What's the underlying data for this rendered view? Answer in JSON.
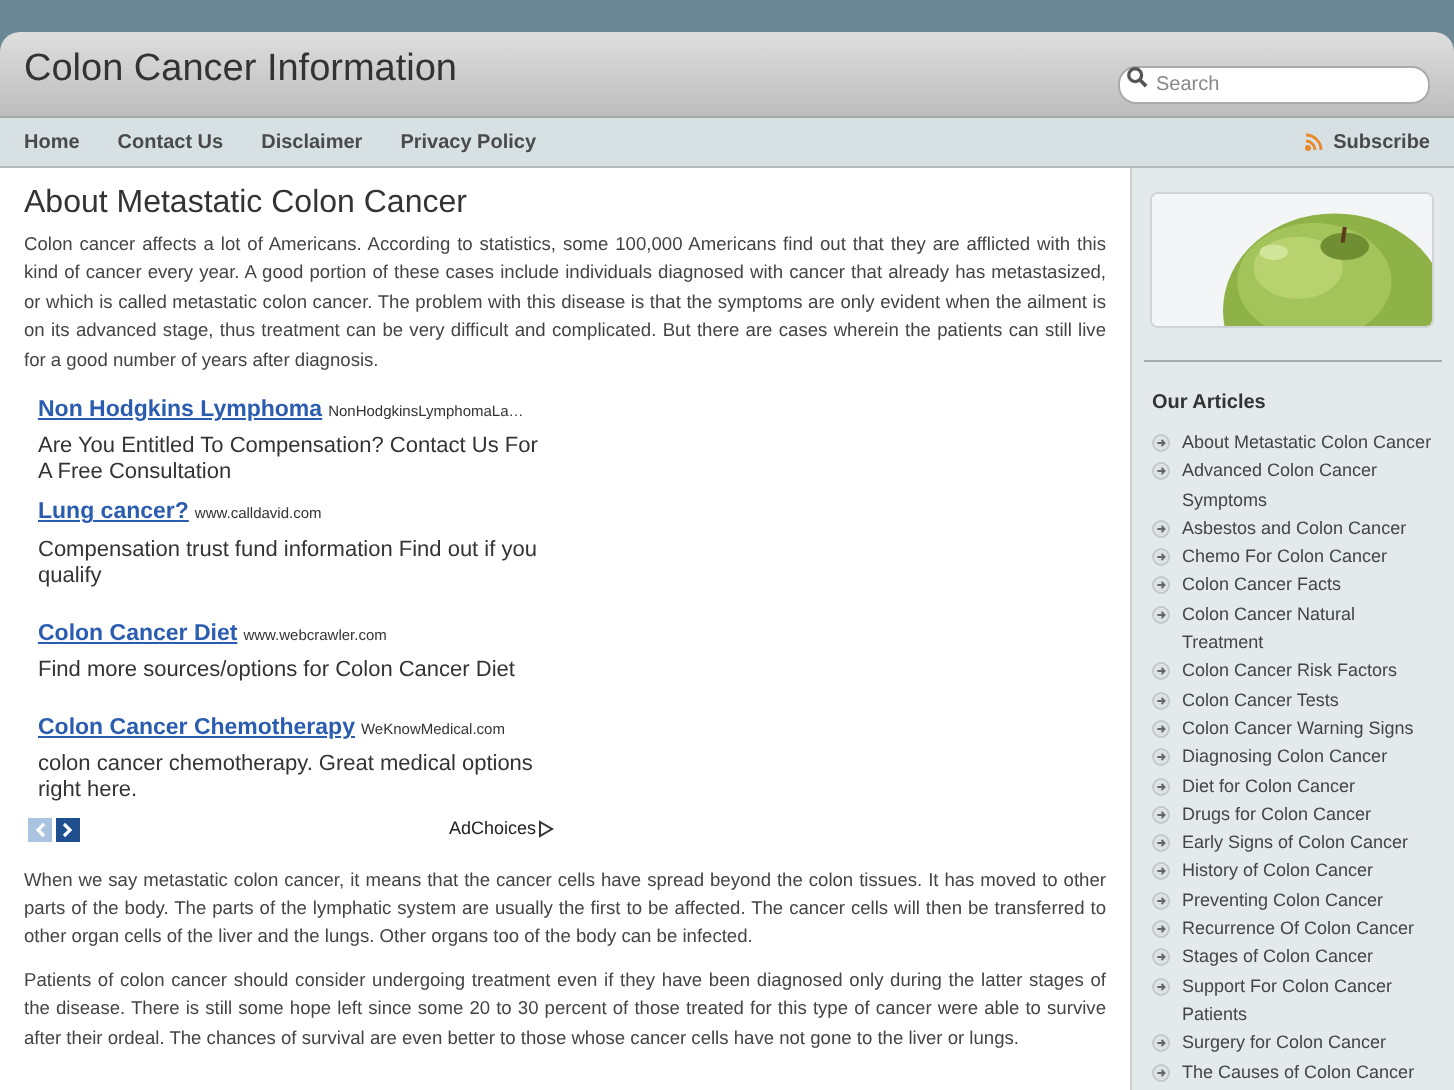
{
  "site_title": "Colon Cancer Information",
  "search": {
    "placeholder": "Search"
  },
  "nav": [
    {
      "label": "Home"
    },
    {
      "label": "Contact Us"
    },
    {
      "label": "Disclaimer"
    },
    {
      "label": "Privacy Policy"
    }
  ],
  "subscribe": "Subscribe",
  "article": {
    "title": "About Metastatic Colon Cancer",
    "paragraphs_before": [
      "Colon cancer affects a lot of Americans. According to statistics, some 100,000 Americans find out that they are afflicted with this kind of cancer every year. A good portion of these cases include individuals diagnosed with cancer that already has metastasized, or which is called metastatic colon cancer. The problem with this disease is that the symptoms are only evident when the ailment is on its advanced stage, thus treatment can be very difficult and complicated. But there are cases wherein the patients can still live for a good number of years after diagnosis."
    ],
    "ads": [
      {
        "title": "Non Hodgkins Lymphoma",
        "url": "NonHodgkinsLymphomaLa…",
        "text": "Are You Entitled To Compensation? Contact Us For A Free Consultation"
      },
      {
        "title": "Lung cancer?",
        "url": "www.calldavid.com",
        "text": "Compensation trust fund information Find out if you qualify"
      },
      {
        "title": "Colon Cancer Diet",
        "url": "www.webcrawler.com",
        "text": "Find more sources/options for Colon Cancer Diet"
      },
      {
        "title": "Colon Cancer Chemotherapy",
        "url": "WeKnowMedical.com",
        "text": "colon cancer chemotherapy. Great medical options right here."
      }
    ],
    "ad_prev_disabled": true,
    "adchoices": "AdChoices",
    "paragraphs_after": [
      "When we say metastatic colon cancer, it means that the cancer cells have spread beyond the colon tissues. It has moved to other parts of the body. The parts of the lymphatic system are usually the first to be affected. The cancer cells will then be transferred to other organ cells of the liver and the lungs. Other organs too of the body can be infected.",
      "Patients of colon cancer should consider undergoing treatment even if they have been diagnosed only during the latter stages of the disease. There is still some hope left since some 20 to 30 percent of those treated for this type of cancer were able to survive after their ordeal. The chances of survival are even better to those whose cancer cells have not gone to the liver or lungs."
    ]
  },
  "sidebar": {
    "heading": "Our Articles",
    "items": [
      "About Metastatic Colon Cancer",
      "Advanced Colon Cancer Symptoms",
      "Asbestos and Colon Cancer",
      "Chemo For Colon Cancer",
      "Colon Cancer Facts",
      "Colon Cancer Natural Treatment",
      "Colon Cancer Risk Factors",
      "Colon Cancer Tests",
      "Colon Cancer Warning Signs",
      "Diagnosing Colon Cancer",
      "Diet for Colon Cancer",
      "Drugs for Colon Cancer",
      "Early Signs of Colon Cancer",
      "History of Colon Cancer",
      "Preventing Colon Cancer",
      "Recurrence Of Colon Cancer",
      "Stages of Colon Cancer",
      "Support For Colon Cancer Patients",
      "Surgery for Colon Cancer",
      "The Causes of Colon Cancer"
    ]
  }
}
